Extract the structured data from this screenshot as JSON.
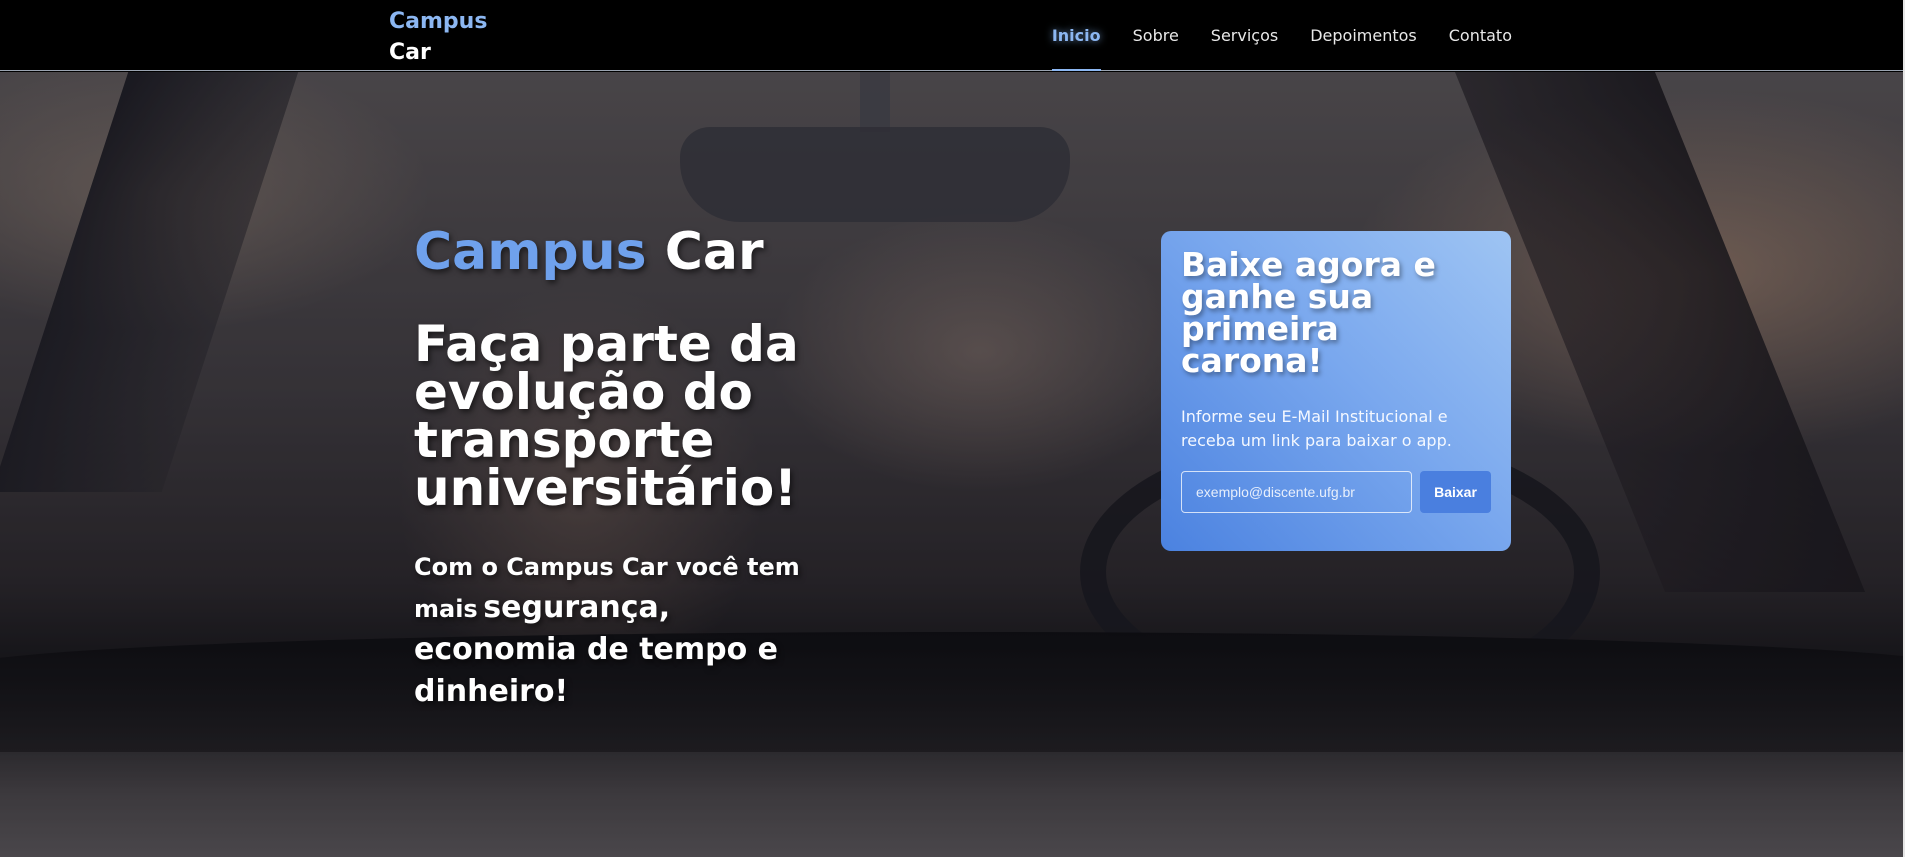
{
  "navbar": {
    "brand_line1": "Campus",
    "brand_line2": "Car",
    "links": [
      {
        "label": "Inicio",
        "active": true
      },
      {
        "label": "Sobre",
        "active": false
      },
      {
        "label": "Serviços",
        "active": false
      },
      {
        "label": "Depoimentos",
        "active": false
      },
      {
        "label": "Contato",
        "active": false
      }
    ]
  },
  "hero": {
    "brand_part1": "Campus",
    "brand_part2": "Car",
    "headline": "Faça parte da evolução do transporte universitário!",
    "sub_part1": "Com o Campus Car você tem mais",
    "sub_part2": "segurança, economia de tempo e dinheiro!"
  },
  "cta": {
    "title": "Baixe agora e ganhe sua primeira carona!",
    "description": "Informe seu E-Mail Institucional e receba um link para baixar o app.",
    "email_placeholder": "exemplo@discente.ufg.br",
    "email_value": "",
    "button_label": "Baixar"
  },
  "colors": {
    "accent": "#8cb7f2",
    "brand_blue": "#6fa1ec",
    "button_blue": "#4a7fdf",
    "navbar_bg": "#000000"
  }
}
